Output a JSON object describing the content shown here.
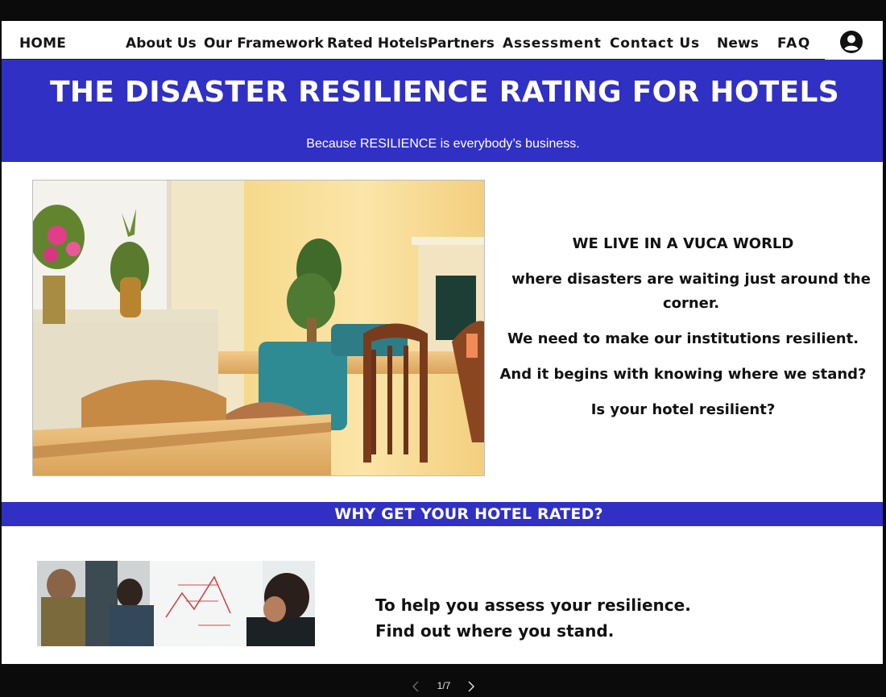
{
  "nav": {
    "home": "HOME",
    "items": [
      "About Us",
      "Our Framework",
      "Rated Hotels",
      "Partners",
      "Assessment",
      "Contact Us",
      "News",
      "FAQ"
    ],
    "account_icon": "user-circle-icon"
  },
  "hero": {
    "title": "THE DISASTER RESILIENCE RATING FOR HOTELS",
    "subtitle": "Because RESILIENCE is everybody’s business."
  },
  "vuca": {
    "line1": "WE LIVE IN A VUCA WORLD",
    "line2": "where disasters are waiting just around the corner.",
    "line3": "We need to make our institutions resilient.",
    "line4": "And it begins with knowing where we stand?",
    "line5": "Is your hotel resilient?"
  },
  "why": {
    "title": "WHY GET YOUR HOTEL RATED?"
  },
  "assess": {
    "line1": "To help you assess your resilience.",
    "line2": "Find out where you stand."
  },
  "pager": {
    "label": "1/7",
    "prev_icon": "chevron-left-icon",
    "next_icon": "chevron-right-icon"
  },
  "colors": {
    "brand_blue": "#3030c4",
    "frame": "#0b0b0b"
  }
}
